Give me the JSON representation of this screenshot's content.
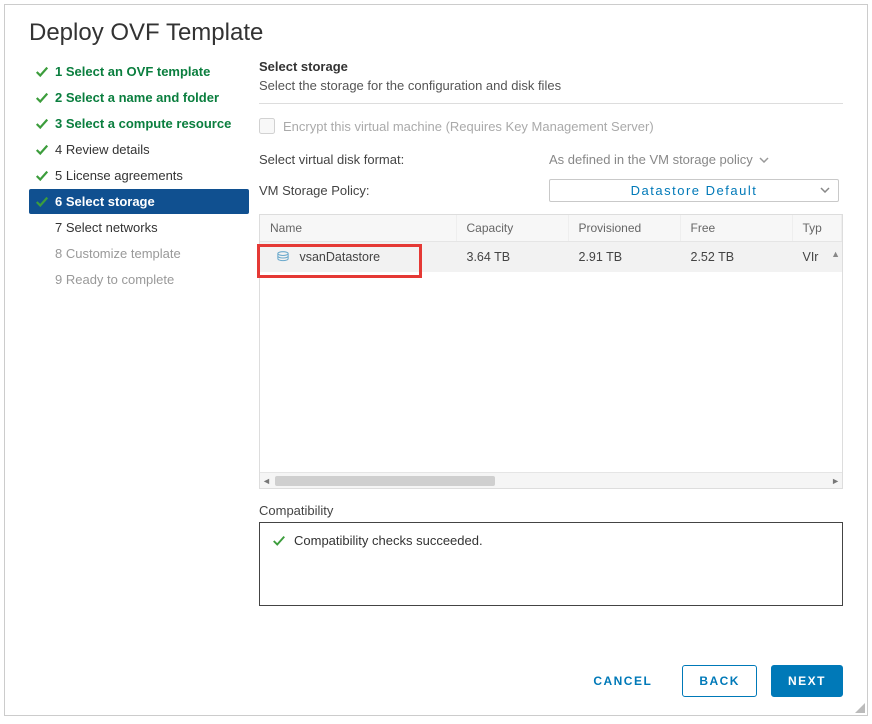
{
  "dialog": {
    "title": "Deploy OVF Template"
  },
  "steps": [
    {
      "label": "1 Select an OVF template",
      "state": "completed"
    },
    {
      "label": "2 Select a name and folder",
      "state": "completed"
    },
    {
      "label": "3 Select a compute resource",
      "state": "completed"
    },
    {
      "label": "4 Review details",
      "state": "completed"
    },
    {
      "label": "5 License agreements",
      "state": "completed"
    },
    {
      "label": "6 Select storage",
      "state": "active"
    },
    {
      "label": "7 Select networks",
      "state": "pending"
    },
    {
      "label": "8 Customize template",
      "state": "disabled"
    },
    {
      "label": "9 Ready to complete",
      "state": "disabled"
    }
  ],
  "main": {
    "title": "Select storage",
    "description": "Select the storage for the configuration and disk files",
    "encrypt_label": "Encrypt this virtual machine (Requires Key Management Server)",
    "encrypt_checked": false,
    "disk_format_label": "Select virtual disk format:",
    "disk_format_value": "As defined in the VM storage policy",
    "policy_label": "VM Storage Policy:",
    "policy_value": "Datastore Default"
  },
  "table": {
    "columns": [
      "Name",
      "Capacity",
      "Provisioned",
      "Free",
      "Typ"
    ],
    "rows": [
      {
        "name": "vsanDatastore",
        "capacity": "3.64 TB",
        "provisioned": "2.91 TB",
        "free": "2.52 TB",
        "type": "VIr"
      }
    ]
  },
  "compat": {
    "label": "Compatibility",
    "message": "Compatibility checks succeeded."
  },
  "footer": {
    "cancel": "CANCEL",
    "back": "BACK",
    "next": "NEXT"
  }
}
